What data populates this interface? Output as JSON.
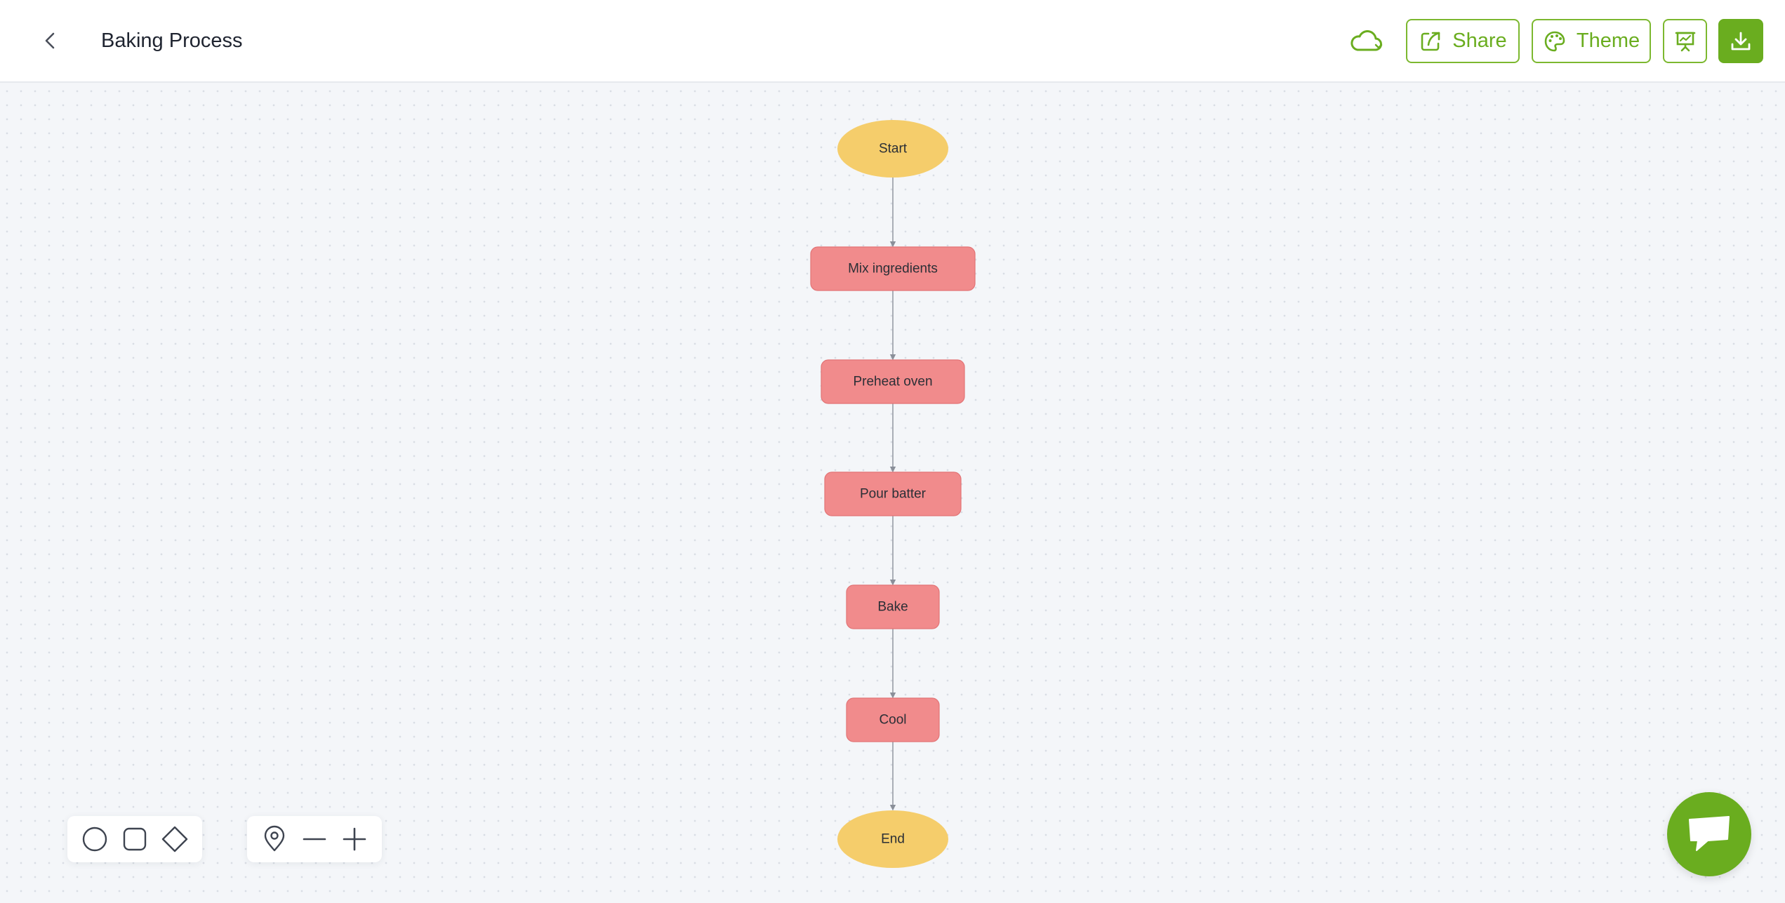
{
  "header": {
    "title": "Baking Process",
    "share_label": "Share",
    "theme_label": "Theme"
  },
  "colors": {
    "accent": "#6aad1f",
    "terminal_fill": "#f5cd6b",
    "process_fill": "#f18b8c",
    "process_stroke": "#e27476",
    "edge": "#8a8f99"
  },
  "flowchart": {
    "nodes": [
      {
        "id": "start",
        "label": "Start",
        "shape": "ellipse"
      },
      {
        "id": "mix",
        "label": "Mix ingredients",
        "shape": "rounded-rect"
      },
      {
        "id": "preheat",
        "label": "Preheat oven",
        "shape": "rounded-rect"
      },
      {
        "id": "pour",
        "label": "Pour batter",
        "shape": "rounded-rect"
      },
      {
        "id": "bake",
        "label": "Bake",
        "shape": "rounded-rect"
      },
      {
        "id": "cool",
        "label": "Cool",
        "shape": "rounded-rect"
      },
      {
        "id": "end",
        "label": "End",
        "shape": "ellipse"
      }
    ],
    "edges": [
      {
        "from": "start",
        "to": "mix"
      },
      {
        "from": "mix",
        "to": "preheat"
      },
      {
        "from": "preheat",
        "to": "pour"
      },
      {
        "from": "pour",
        "to": "bake"
      },
      {
        "from": "bake",
        "to": "cool"
      },
      {
        "from": "cool",
        "to": "end"
      }
    ]
  },
  "icons": {
    "back": "chevron-left-icon",
    "cloud": "cloud-sync-icon",
    "share": "share-icon",
    "theme": "palette-icon",
    "present": "presentation-icon",
    "download": "download-icon",
    "shape_ellipse": "ellipse-icon",
    "shape_rect": "rounded-square-icon",
    "shape_diamond": "diamond-icon",
    "locate": "location-pin-icon",
    "zoom_out": "minus-icon",
    "zoom_in": "plus-icon",
    "chat": "chat-bubble-icon"
  }
}
